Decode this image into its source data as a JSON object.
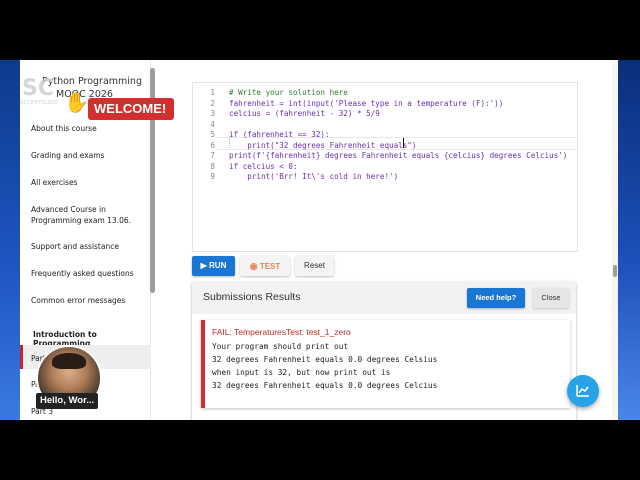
{
  "sidebar": {
    "course_title_line1": "Python Programming",
    "course_title_line2": "MOOC 2026",
    "items": [
      {
        "label": "About this course"
      },
      {
        "label": "Grading and exams"
      },
      {
        "label": "All exercises"
      },
      {
        "label": "Advanced Course in Programming exam 13.06."
      },
      {
        "label": "Support and assistance"
      },
      {
        "label": "Frequently asked questions"
      },
      {
        "label": "Common error messages"
      }
    ],
    "section_title": "Introduction to Programming",
    "parts": [
      {
        "label": "Part 1"
      },
      {
        "label": "Part 2"
      },
      {
        "label": "Part 3"
      }
    ]
  },
  "overlay": {
    "welcome_text": "WELCOME!",
    "logo_big": "SC",
    "logo_small": "screencast",
    "webcam_label": "Hello, Wor..."
  },
  "editor": {
    "lines": [
      {
        "n": "1",
        "code": "# Write your solution here",
        "comment": true
      },
      {
        "n": "2",
        "code": "fahrenheit = int(input('Please type in a temperature (F):'))",
        "comment": false
      },
      {
        "n": "3",
        "code": "celcius = (fahrenheit - 32) * 5/9",
        "comment": false
      },
      {
        "n": "4",
        "code": "",
        "comment": false
      },
      {
        "n": "5",
        "code": "if (fahrenheit == 32):",
        "comment": false
      },
      {
        "n": "6",
        "code": "    print(\"32 degrees Fahrenheit equals\")",
        "comment": false
      },
      {
        "n": "7",
        "code": "print(f'{fahrenheit} degrees Fahrenheit equals {celcius} degrees Celcius')",
        "comment": false
      },
      {
        "n": "8",
        "code": "if celcius < 0:",
        "comment": false
      },
      {
        "n": "9",
        "code": "    print('Brr! It\\'s cold in here!')",
        "comment": false
      }
    ]
  },
  "toolbar": {
    "run_label": "RUN",
    "test_label": "TEST",
    "reset_label": "Reset"
  },
  "results": {
    "title": "Submissions Results",
    "need_help_label": "Need help?",
    "close_label": "Close",
    "fail_title": "FAIL: TemperaturesTest: test_1_zero",
    "fail_lines": [
      "Your program should print out",
      "32 degrees Fahrenheit equals 0.0 degrees Celsius",
      "when input is 32, but now print out is",
      "32 degrees Fahrenheit equals 0.0 degrees Celcius"
    ]
  },
  "colors": {
    "primary": "#1976d2",
    "fail": "#d32f2f",
    "test_accent": "#e8865a",
    "fab": "#29a3e6"
  },
  "icons": {
    "run": "play-icon",
    "test": "eye-icon",
    "fab": "chart-icon",
    "wave": "waving-hand-icon"
  }
}
